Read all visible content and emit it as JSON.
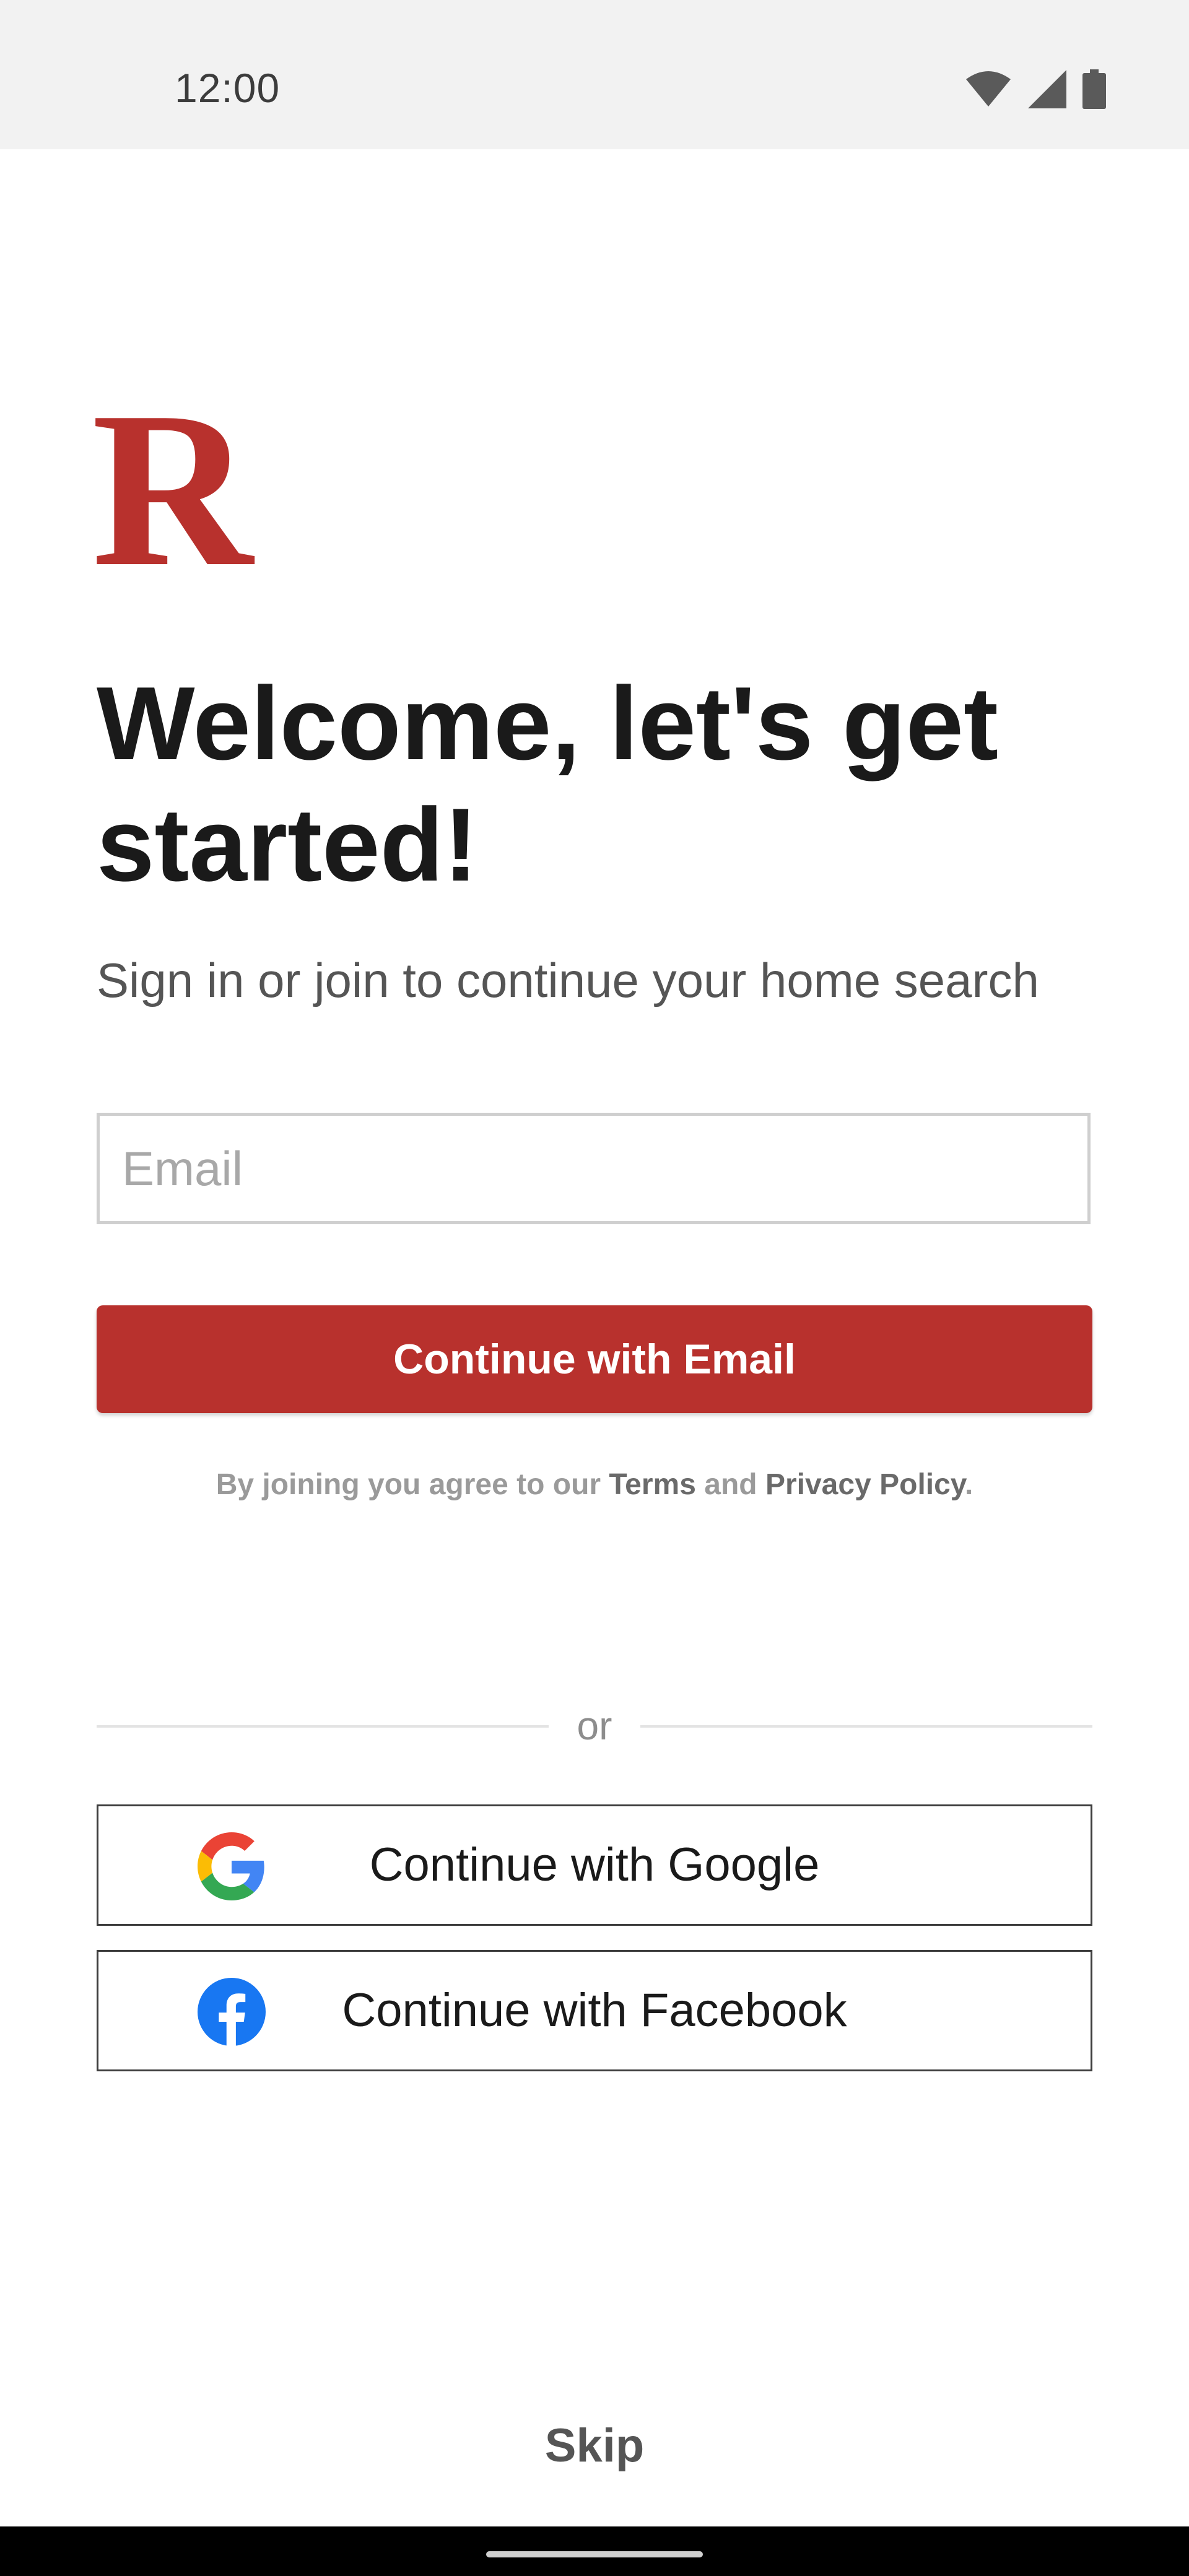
{
  "status_bar": {
    "time": "12:00",
    "icons": [
      "wifi-icon",
      "cellular-signal-icon",
      "battery-icon"
    ]
  },
  "brand": {
    "logo_letter": "R",
    "color": "#b8312d"
  },
  "headline": "Welcome, let's get started!",
  "subhead": "Sign in or join to continue your home search",
  "email_field": {
    "placeholder": "Email",
    "value": ""
  },
  "email_button_label": "Continue with Email",
  "terms": {
    "prefix": "By joining you agree to our ",
    "terms_link": "Terms",
    "middle": " and ",
    "privacy_link": "Privacy Policy",
    "suffix": "."
  },
  "divider_label": "or",
  "social": {
    "google": {
      "label": "Continue with Google",
      "icon": "google-icon"
    },
    "facebook": {
      "label": "Continue with Facebook",
      "icon": "facebook-icon"
    }
  },
  "skip_label": "Skip"
}
